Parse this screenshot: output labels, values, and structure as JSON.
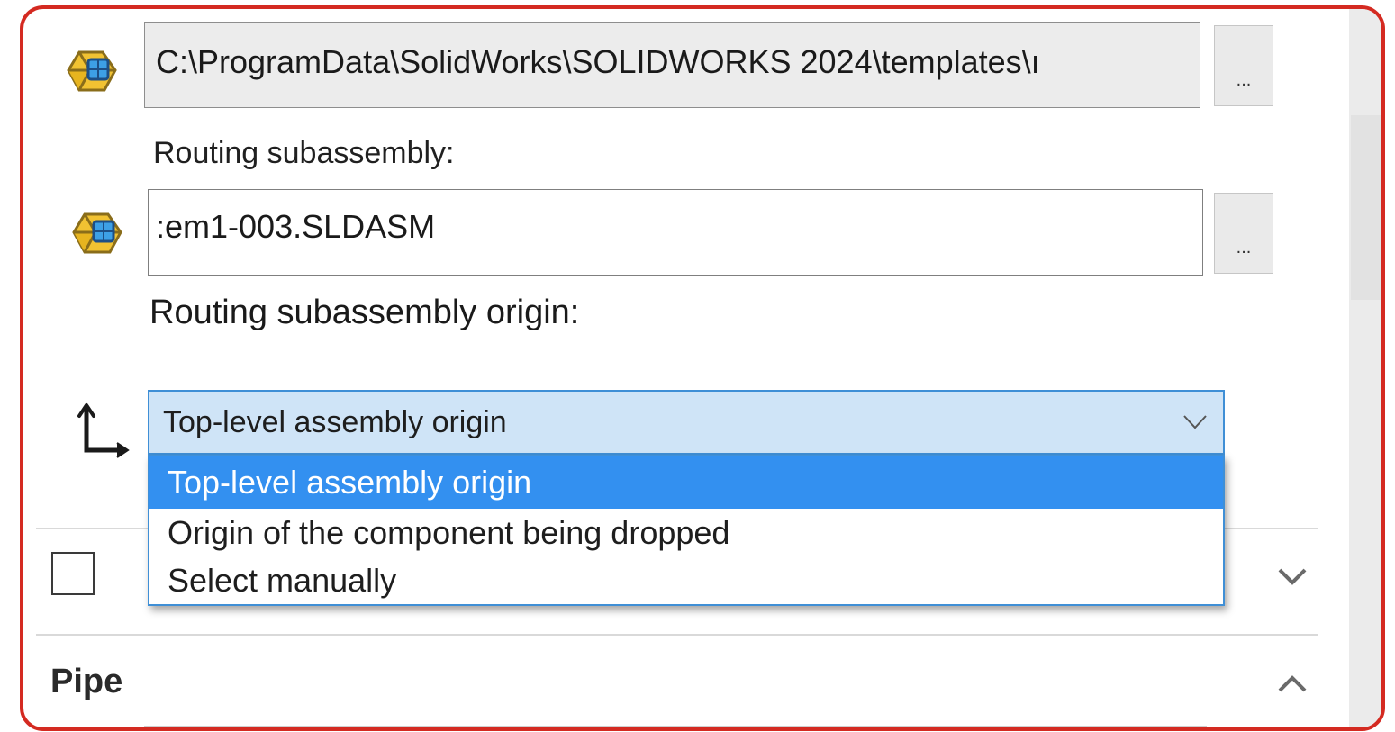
{
  "template_row": {
    "path_value": "C:\\ProgramData\\SolidWorks\\SOLIDWORKS 2024\\templates\\ı",
    "browse_label": "...",
    "icon": "assembly-icon"
  },
  "routing_subassembly": {
    "label": "Routing subassembly:",
    "value": ":em1-003.SLDASM",
    "browse_label": "...",
    "icon": "assembly-icon"
  },
  "origin": {
    "label": "Routing subassembly origin:",
    "icon": "coordinate-axes-icon",
    "selected": "Top-level assembly origin",
    "options": [
      "Top-level assembly origin",
      "Origin of the component being dropped",
      "Select manually"
    ]
  },
  "collapsed_section": {
    "checked": false,
    "icon": "chevron-down-icon"
  },
  "pipe_section": {
    "title": "Pipe",
    "icon": "chevron-up-icon"
  },
  "colors": {
    "frame_border": "#d42a21",
    "selection": "#3390f0",
    "combo_fill": "#cfe4f7",
    "combo_border": "#3f8fd6"
  }
}
